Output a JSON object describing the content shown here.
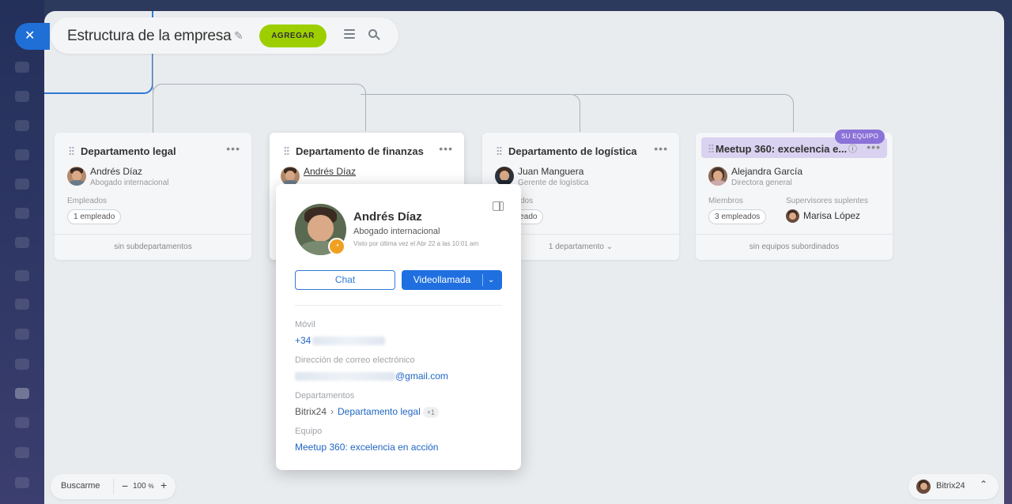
{
  "app": {
    "close_icon": "close-icon"
  },
  "header": {
    "title": "Estructura de la empresa",
    "add_label": "AGREGAR",
    "icons": [
      "pin-icon",
      "menu-icon",
      "search-icon"
    ]
  },
  "cards": [
    {
      "name": "Departamento legal",
      "person_name": "Andrés Díaz",
      "person_role": "Abogado internacional",
      "label": "Empleados",
      "pill": "1 empleado",
      "footer": "sin subdepartamentos"
    },
    {
      "name": "Departamento de finanzas",
      "person_name": "Andrés Díaz",
      "person_role": "Abogado internacional"
    },
    {
      "name": "Departamento de logística",
      "person_name": "Juan Manguera",
      "person_role": "Gerente de logística",
      "label": "dos",
      "pill": "leado",
      "footer": "1 departamento"
    },
    {
      "name": "Meetup 360: excelencia e...",
      "badge": "SU EQUIPO",
      "person_name": "Alejandra García",
      "person_role": "Directora general",
      "label": "Miembros",
      "pill": "3 empleados",
      "label2": "Supervisores suplentes",
      "deputy_name": "Marisa López",
      "footer": "sin equipos subordinados"
    }
  ],
  "popup": {
    "name": "Andrés Díaz",
    "role": "Abogado internacional",
    "last_seen": "Visto por última vez el Abr 22 a las 10:01 am",
    "chat_label": "Chat",
    "video_label": "Videollamada",
    "mobile_label": "Móvil",
    "mobile_value": "+34",
    "email_label": "Dirección de correo electrónico",
    "email_value": "@gmail.com",
    "departments_label": "Departamentos",
    "dept_root": "Bitrix24",
    "dept_name": "Departamento legal",
    "dept_more": "+1",
    "team_label": "Equipo",
    "team_value": "Meetup 360: excelencia en acción"
  },
  "bottom_left": {
    "find_label": "Buscarme",
    "zoom_minus": "−",
    "zoom_value": "100",
    "zoom_unit": "%",
    "zoom_plus": "+"
  },
  "bottom_right": {
    "label": "Bitrix24",
    "collapse_icon": "double-chevron-up-icon"
  }
}
